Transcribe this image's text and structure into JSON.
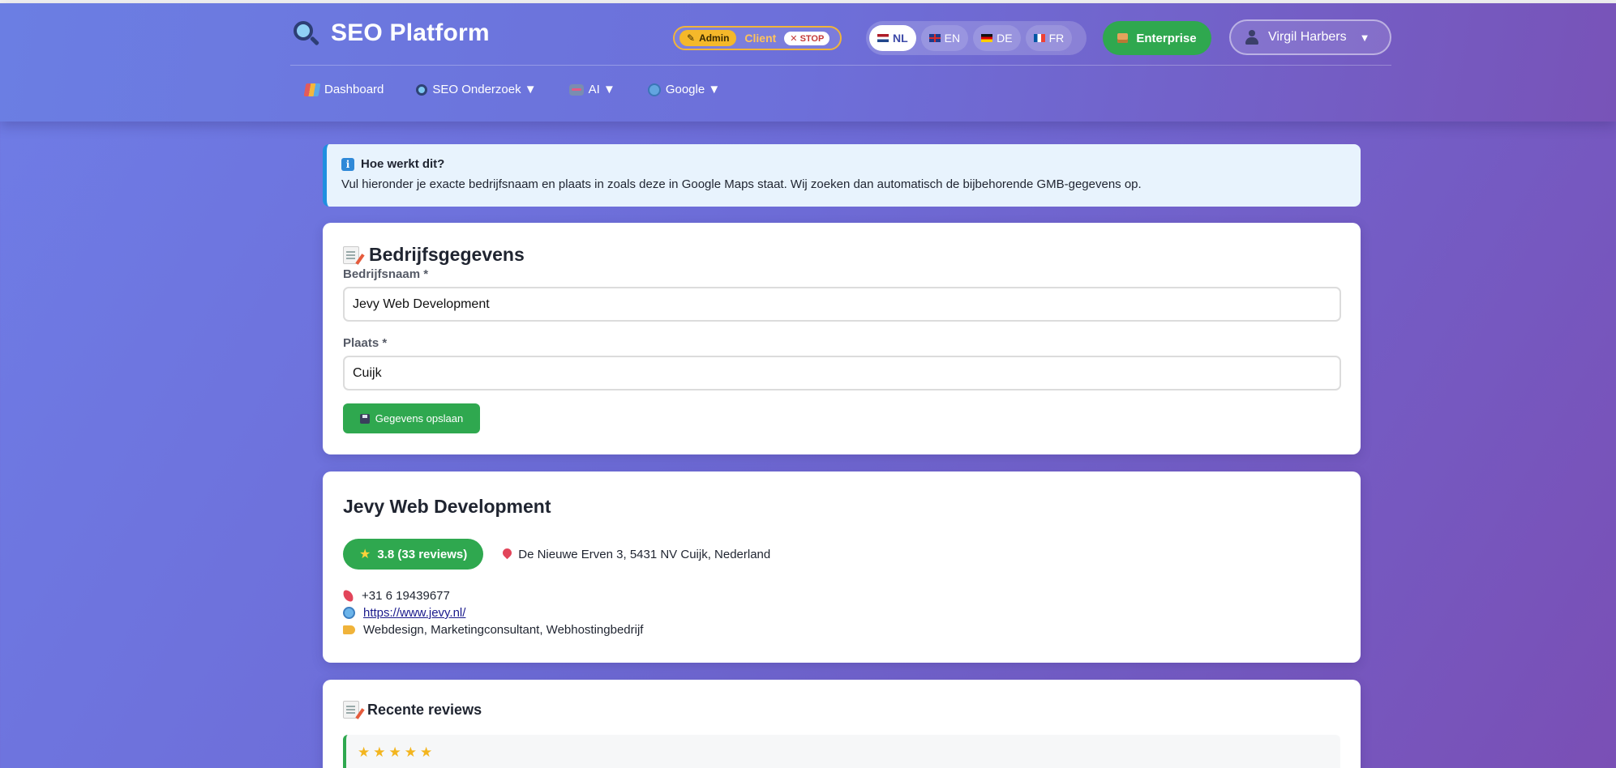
{
  "header": {
    "brand_title": "SEO Platform",
    "role": {
      "admin_label": "Admin",
      "client_label": "Client",
      "stop_label": "✕ STOP"
    },
    "languages": [
      {
        "code": "NL",
        "active": true
      },
      {
        "code": "EN",
        "active": false
      },
      {
        "code": "DE",
        "active": false
      },
      {
        "code": "FR",
        "active": false
      }
    ],
    "plan_label": "Enterprise",
    "user_name": "Virgil Harbers",
    "user_caret": "▼",
    "nav": [
      {
        "label": "Dashboard",
        "icon": "dashboard-icon",
        "has_dropdown": false
      },
      {
        "label": "SEO Onderzoek ▼",
        "icon": "search-icon",
        "has_dropdown": true
      },
      {
        "label": "AI ▼",
        "icon": "ai-icon",
        "has_dropdown": true
      },
      {
        "label": "Google ▼",
        "icon": "globe-icon",
        "has_dropdown": true
      }
    ]
  },
  "info": {
    "title": "Hoe werkt dit?",
    "text": "Vul hieronder je exacte bedrijfsnaam en plaats in zoals deze in Google Maps staat. Wij zoeken dan automatisch de bijbehorende GMB-gegevens op."
  },
  "form": {
    "title": "Bedrijfsgegevens",
    "name_label": "Bedrijfsnaam *",
    "name_value": "Jevy Web Development",
    "city_label": "Plaats *",
    "city_value": "Cuijk",
    "save_label": "Gegevens opslaan"
  },
  "business": {
    "name": "Jevy Web Development",
    "rating_label": "3.8 (33 reviews)",
    "rating": 3.8,
    "review_count": 33,
    "address": "De Nieuwe Erven 3, 5431 NV Cuijk, Nederland",
    "phone": "+31 6 19439677",
    "website": "https://www.jevy.nl/",
    "categories": "Webdesign, Marketingconsultant, Webhostingbedrijf"
  },
  "reviews": {
    "title": "Recente reviews",
    "items": [
      {
        "stars": 5,
        "stars_text": "★★★★★"
      }
    ]
  },
  "colors": {
    "accent_green": "#2fa84f",
    "info_blue": "#1f8fe0",
    "role_gold": "#f5b82a",
    "gradient_start": "#6f7de6",
    "gradient_end": "#7a4fb5"
  }
}
